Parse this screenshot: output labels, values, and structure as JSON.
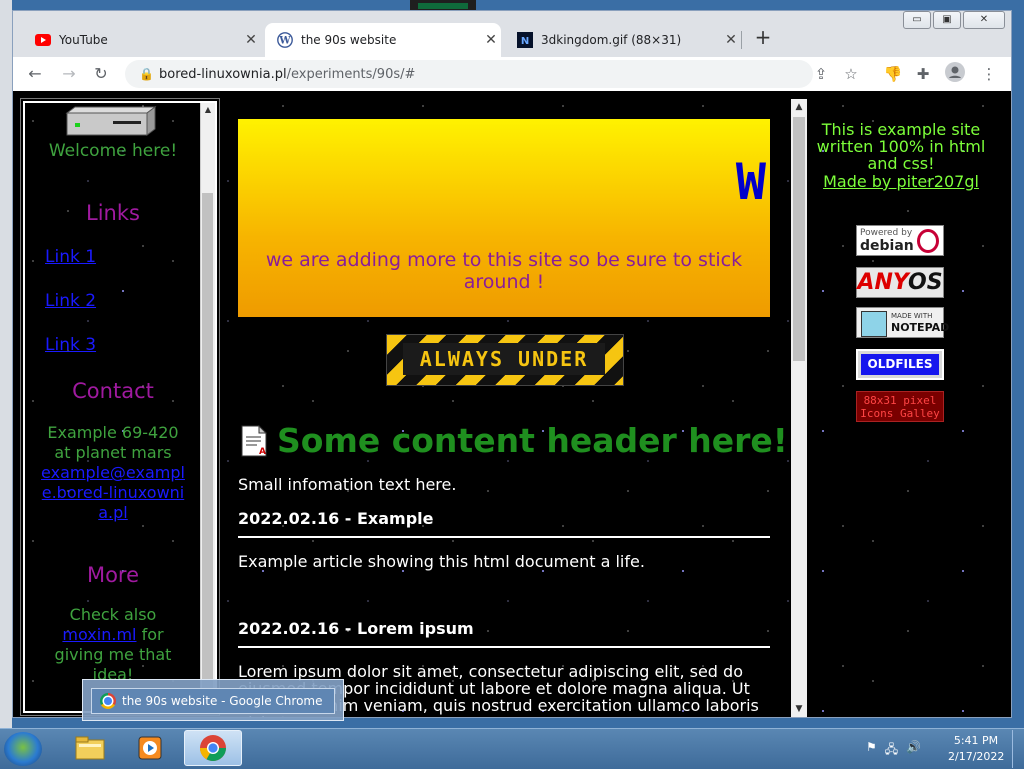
{
  "browser": {
    "tabs": [
      {
        "title": "YouTube",
        "icon": "youtube-icon"
      },
      {
        "title": "the 90s website",
        "icon": "wordpress-icon"
      },
      {
        "title": "3dkingdom.gif (88×31)",
        "icon": "image-icon"
      }
    ],
    "url": {
      "host": "bored-linuxownia.pl",
      "path": "/experiments/90s/#"
    }
  },
  "left": {
    "welcome": "Welcome here!",
    "links_heading": "Links",
    "links": [
      "Link 1",
      "Link 2",
      "Link 3"
    ],
    "contact_heading": "Contact",
    "contact_text": "Example 69-420 at planet mars",
    "contact_email": "example@example.bored-linuxownia.pl",
    "more_heading": "More",
    "more_prefix": "Check also",
    "more_link": "moxin.ml",
    "more_suffix": "for giving me that idea!"
  },
  "main": {
    "banner_letter": "W",
    "banner_message": "we are adding more to this site so be sure to stick around !",
    "construction_label": "ALWAYS UNDER",
    "content_header": "Some content header here!",
    "small_info": "Small infomation text here.",
    "articles": [
      {
        "title": "2022.02.16 - Example",
        "body": "Example article showing this html document a life."
      },
      {
        "title": "2022.02.16 - Lorem ipsum",
        "body": "Lorem ipsum dolor sit amet, consectetur adipiscing elit, sed do eiusmod tempor incididunt ut labore et dolore magna aliqua. Ut enim ad minim veniam, quis nostrud exercitation ullamco laboris nisi ut"
      }
    ]
  },
  "right": {
    "intro": "This is example site written 100% in html and css!",
    "made_by": "Made by piter207gl",
    "badges": {
      "debian_top": "Powered by",
      "debian_main": "debian",
      "anyos_a": "ANY",
      "anyos_b": "OS",
      "notepad_top": "MADE WITH",
      "notepad_main": "NOTEPAD",
      "oldfiles": "OLDFILES",
      "icons_line1": "88x31 pixel",
      "icons_line2": "Icons Galley"
    }
  },
  "taskbar": {
    "tooltip": "the 90s website - Google Chrome",
    "time": "5:41 PM",
    "date": "2/17/2022"
  },
  "colors": {
    "green_text": "#3fa33f",
    "purple_heading": "#a01aa0",
    "link_blue": "#1a1aff",
    "lime": "#7dff3a"
  }
}
